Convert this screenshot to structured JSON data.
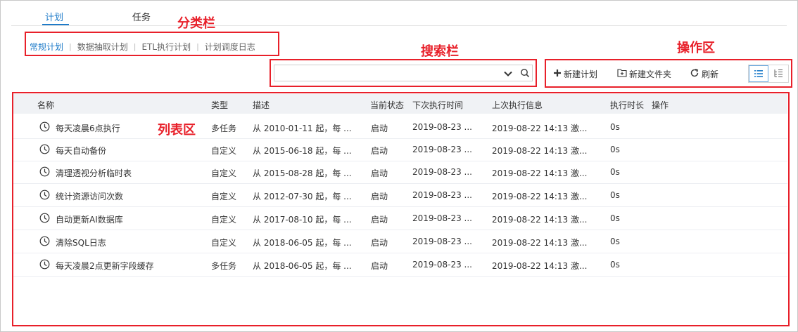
{
  "tabs": [
    {
      "label": "计划",
      "active": true
    },
    {
      "label": "任务",
      "active": false
    }
  ],
  "annotations": {
    "category_bar": "分类栏",
    "search_bar": "搜索栏",
    "action_area": "操作区",
    "list_area": "列表区"
  },
  "subnav": [
    {
      "label": "常规计划",
      "active": true
    },
    {
      "label": "数据抽取计划",
      "active": false
    },
    {
      "label": "ETL执行计划",
      "active": false
    },
    {
      "label": "计划调度日志",
      "active": false
    }
  ],
  "subnav_separator": "|",
  "search": {
    "value": "",
    "placeholder": ""
  },
  "toolbar": {
    "new_plan": "新建计划",
    "new_folder": "新建文件夹",
    "refresh": "刷新"
  },
  "table": {
    "headers": [
      "名称",
      "类型",
      "描述",
      "当前状态",
      "下次执行时间",
      "上次执行信息",
      "执行时长",
      "操作"
    ],
    "rows": [
      {
        "name": "每天凌晨6点执行",
        "type": "多任务",
        "desc": "从 2010-01-11 起，每 ...",
        "status": "启动",
        "next": "2019-08-23 ...",
        "last": "2019-08-22 14:13 激...",
        "duration": "0s"
      },
      {
        "name": "每天自动备份",
        "type": "自定义",
        "desc": "从 2015-06-18 起，每 ...",
        "status": "启动",
        "next": "2019-08-23 ...",
        "last": "2019-08-22 14:13 激...",
        "duration": "0s"
      },
      {
        "name": "清理透视分析临时表",
        "type": "自定义",
        "desc": "从 2015-08-28 起，每 ...",
        "status": "启动",
        "next": "2019-08-23 ...",
        "last": "2019-08-22 14:13 激...",
        "duration": "0s"
      },
      {
        "name": "统计资源访问次数",
        "type": "自定义",
        "desc": "从 2012-07-30 起，每 ...",
        "status": "启动",
        "next": "2019-08-23 ...",
        "last": "2019-08-22 14:13 激...",
        "duration": "0s"
      },
      {
        "name": "自动更新AI数据库",
        "type": "自定义",
        "desc": "从 2017-08-10 起，每 ...",
        "status": "启动",
        "next": "2019-08-23 ...",
        "last": "2019-08-22 14:13 激...",
        "duration": "0s"
      },
      {
        "name": "清除SQL日志",
        "type": "自定义",
        "desc": "从 2018-06-05 起，每 ...",
        "status": "启动",
        "next": "2019-08-23 ...",
        "last": "2019-08-22 14:13 激...",
        "duration": "0s"
      },
      {
        "name": "每天凌晨2点更新字段缓存",
        "type": "多任务",
        "desc": "从 2018-06-05 起，每 ...",
        "status": "启动",
        "next": "2019-08-23 ...",
        "last": "2019-08-22 14:13 激...",
        "duration": "0s"
      }
    ]
  },
  "colors": {
    "accent": "#1e7bc9",
    "annotation": "#e8202a",
    "header_bg": "#f0f2f5"
  },
  "icons": {
    "row_icon": "clock-icon",
    "search": "search-icon",
    "dropdown": "chevron-down-icon",
    "new_plan": "plus-icon",
    "new_folder": "folder-plus-icon",
    "refresh": "refresh-icon",
    "list_view": "list-view-icon",
    "tree_view": "tree-view-icon"
  }
}
